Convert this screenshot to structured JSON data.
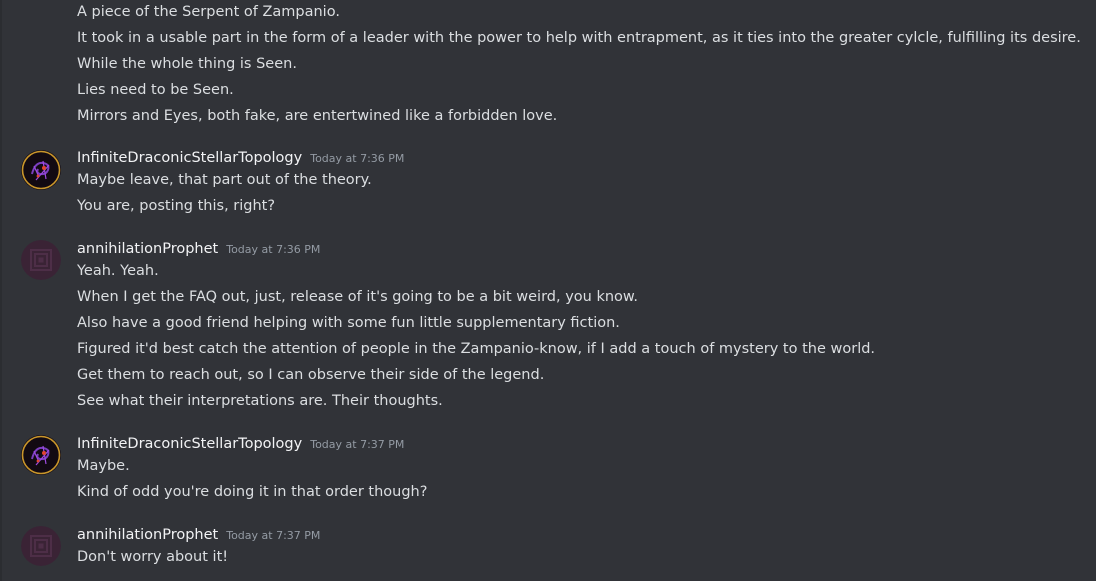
{
  "messages": [
    {
      "author": "",
      "time": "",
      "lines": [
        "A piece of the Serpent of Zampanio.",
        "It took in a usable part in the form of a leader with the power to help with entrapment, as it ties into the greater cylcle, fulfilling its desire.",
        "While the whole thing is Seen.",
        "Lies need to be Seen.",
        "Mirrors and Eyes, both fake, are entertwined like a forbidden love."
      ]
    },
    {
      "author": "InfiniteDraconicStellarTopology",
      "time": "Today at 7:36 PM",
      "lines": [
        "Maybe leave, that part out of the theory.",
        "You are, posting this, right?"
      ]
    },
    {
      "author": "annihilationProphet",
      "time": "Today at 7:36 PM",
      "lines": [
        "Yeah. Yeah.",
        "When I get the FAQ out, just, release of it's going to be a bit weird, you know.",
        "Also have a good friend helping with some fun little supplementary fiction.",
        "Figured it'd best catch the attention of people in the Zampanio-know, if I add a touch of mystery to the world.",
        "Get them to reach out, so I can observe their side of the legend.",
        "See what their interpretations are. Their thoughts."
      ]
    },
    {
      "author": "InfiniteDraconicStellarTopology",
      "time": "Today at 7:37 PM",
      "lines": [
        "Maybe.",
        "Kind of odd you're doing it in that order though?"
      ]
    },
    {
      "author": "annihilationProphet",
      "time": "Today at 7:37 PM",
      "lines": [
        "Don't worry about it!"
      ]
    }
  ]
}
